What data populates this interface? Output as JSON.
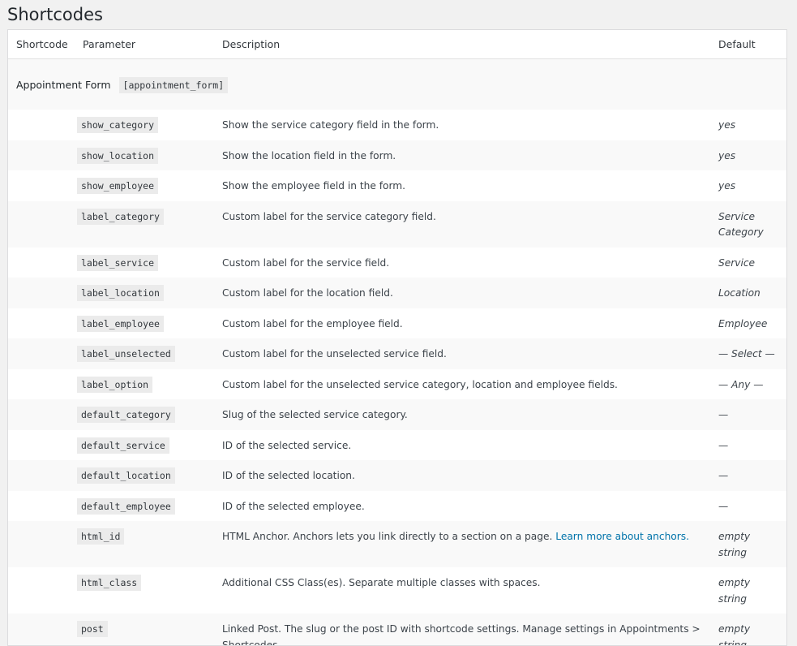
{
  "page": {
    "title": "Shortcodes"
  },
  "table": {
    "headers": {
      "shortcode": "Shortcode",
      "parameter": "Parameter",
      "description": "Description",
      "default": "Default"
    },
    "section": {
      "name": "Appointment Form",
      "code": "[appointment_form]"
    },
    "rows": [
      {
        "param": "show_category",
        "desc": "Show the service category field in the form.",
        "default": "yes"
      },
      {
        "param": "show_location",
        "desc": "Show the location field in the form.",
        "default": "yes"
      },
      {
        "param": "show_employee",
        "desc": "Show the employee field in the form.",
        "default": "yes"
      },
      {
        "param": "label_category",
        "desc": "Custom label for the service category field.",
        "default": "Service Category"
      },
      {
        "param": "label_service",
        "desc": "Custom label for the service field.",
        "default": "Service"
      },
      {
        "param": "label_location",
        "desc": "Custom label for the location field.",
        "default": "Location"
      },
      {
        "param": "label_employee",
        "desc": "Custom label for the employee field.",
        "default": "Employee"
      },
      {
        "param": "label_unselected",
        "desc": "Custom label for the unselected service field.",
        "default": "— Select —"
      },
      {
        "param": "label_option",
        "desc": "Custom label for the unselected service category, location and employee fields.",
        "default": "— Any —"
      },
      {
        "param": "default_category",
        "desc": "Slug of the selected service category.",
        "default": "—"
      },
      {
        "param": "default_service",
        "desc": "ID of the selected service.",
        "default": "—"
      },
      {
        "param": "default_location",
        "desc": "ID of the selected location.",
        "default": "—"
      },
      {
        "param": "default_employee",
        "desc": "ID of the selected employee.",
        "default": "—"
      },
      {
        "param": "html_id",
        "desc": "HTML Anchor. Anchors lets you link directly to a section on a page.",
        "link": "Learn more about anchors.",
        "default": "empty string"
      },
      {
        "param": "html_class",
        "desc": "Additional CSS Class(es). Separate multiple classes with spaces.",
        "default": "empty string"
      },
      {
        "param": "post",
        "desc": "Linked Post. The slug or the post ID with shortcode settings. Manage settings in Appointments > Shortcodes.",
        "default": "empty string"
      }
    ]
  }
}
